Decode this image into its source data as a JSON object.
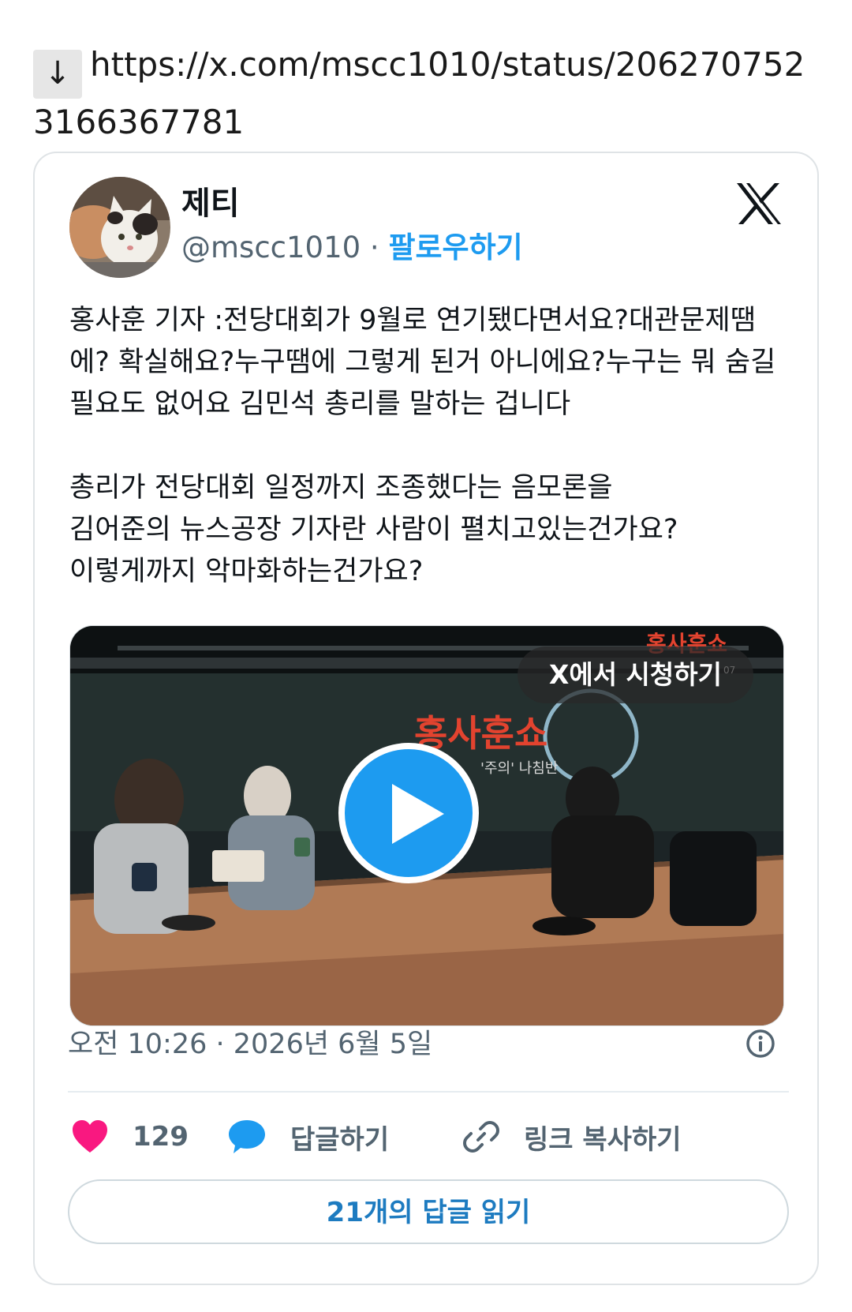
{
  "link": {
    "arrow": "↓",
    "url": "https://x.com/mscc1010/status/2062707523166367781"
  },
  "tweet": {
    "author_name": "제티",
    "handle": "@mscc1010",
    "separator": " · ",
    "follow_label": "팔로우하기",
    "logo": "x-logo-icon",
    "text": "홍사훈 기자 :전당대회가 9월로 연기됐다면서요?대관문제땜에? 확실해요?누구땜에 그렇게 된거 아니에요?누구는 뭐 숨길 필요도 없어요 김민석 총리를 말하는 겁니다\n\n총리가 전당대회 일정까지 조종했다는 음모론을\n김어준의 뉴스공장 기자란 사람이 펼치고있는건가요?\n이렇게까지 악마화하는건가요?",
    "media": {
      "watch_label": "X에서 시청하기",
      "studio_sign": "홍사훈쇼",
      "studio_sub": "'주의' 나침반",
      "corner_sign": "홍사훈쇼",
      "corner_num": "07"
    },
    "timestamp": "오전 10:26 · 2026년 6월 5일",
    "likes": "129",
    "reply_label": "답글하기",
    "copy_link_label": "링크 복사하기",
    "read_replies_label": "21개의 답글 읽기"
  },
  "colors": {
    "accent": "#1d9bf0",
    "heart": "#f91880",
    "muted": "#536471"
  }
}
